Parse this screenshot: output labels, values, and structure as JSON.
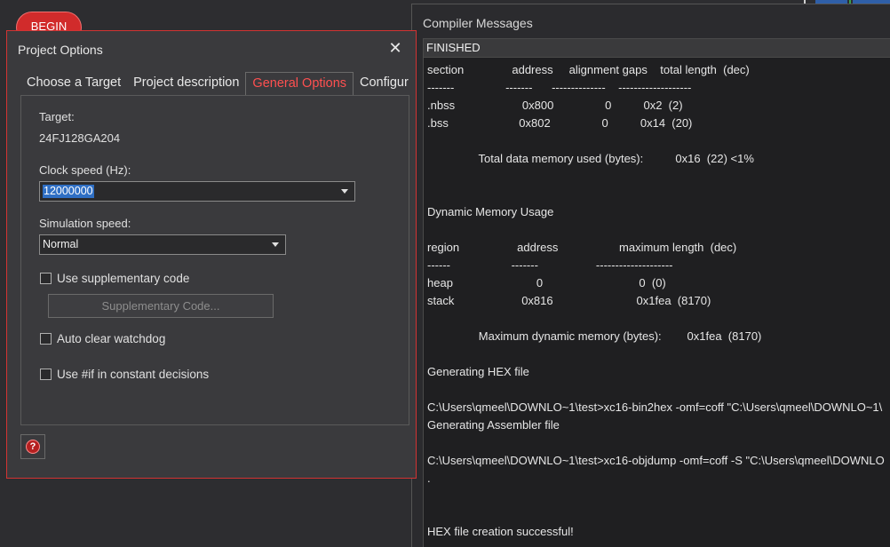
{
  "background": {
    "begin_label": "BEGIN"
  },
  "compiler": {
    "title": "Compiler Messages",
    "status": "FINISHED",
    "lines": [
      {
        "text": "section               address     alignment gaps    total length  (dec)"
      },
      {
        "text": "-------                -------      --------------    -------------------"
      },
      {
        "text": ".nbss                     0x800                0          0x2  (2)"
      },
      {
        "text": ".bss                      0x802                0          0x14  (20)"
      },
      {
        "text": ""
      },
      {
        "text": "                Total data memory used (bytes):          0x16  (22) <1%"
      },
      {
        "text": ""
      },
      {
        "text": ""
      },
      {
        "text": "Dynamic Memory Usage"
      },
      {
        "text": ""
      },
      {
        "text": "region                  address                   maximum length  (dec)"
      },
      {
        "text": "------                   -------                  --------------------"
      },
      {
        "text": "heap                          0                              0  (0)"
      },
      {
        "text": "stack                     0x816                          0x1fea  (8170)"
      },
      {
        "text": ""
      },
      {
        "text": "                Maximum dynamic memory (bytes):        0x1fea  (8170)"
      },
      {
        "text": ""
      },
      {
        "text": "Generating HEX file"
      },
      {
        "text": ""
      },
      {
        "text": "C:\\Users\\qmeel\\DOWNLO~1\\test>xc16-bin2hex -omf=coff \"C:\\Users\\qmeel\\DOWNLO~1\\"
      },
      {
        "text": "Generating Assembler file"
      },
      {
        "text": ""
      },
      {
        "text": "C:\\Users\\qmeel\\DOWNLO~1\\test>xc16-objdump -omf=coff -S \"C:\\Users\\qmeel\\DOWNLO"
      },
      {
        "text": "."
      },
      {
        "text": ""
      },
      {
        "text": ""
      },
      {
        "text": "HEX file creation successful!"
      }
    ]
  },
  "dialog": {
    "title": "Project Options",
    "close_icon": "close-icon",
    "tabs": [
      {
        "label": "Choose a Target",
        "active": false
      },
      {
        "label": "Project description",
        "active": false
      },
      {
        "label": "General Options",
        "active": true
      },
      {
        "label": "Configur",
        "active": false
      }
    ],
    "target_label": "Target:",
    "target_value": "24FJ128GA204",
    "clock_label": "Clock speed (Hz):",
    "clock_value": "12000000",
    "sim_label": "Simulation speed:",
    "sim_value": "Normal",
    "use_supp_label": "Use supplementary code",
    "supp_button_label": "Supplementary Code...",
    "auto_clear_label": "Auto clear watchdog",
    "use_if_label": "Use #if in constant decisions",
    "help_icon": "help-icon"
  },
  "colors": {
    "accent": "#d23333",
    "selection": "#2f6fc4"
  }
}
